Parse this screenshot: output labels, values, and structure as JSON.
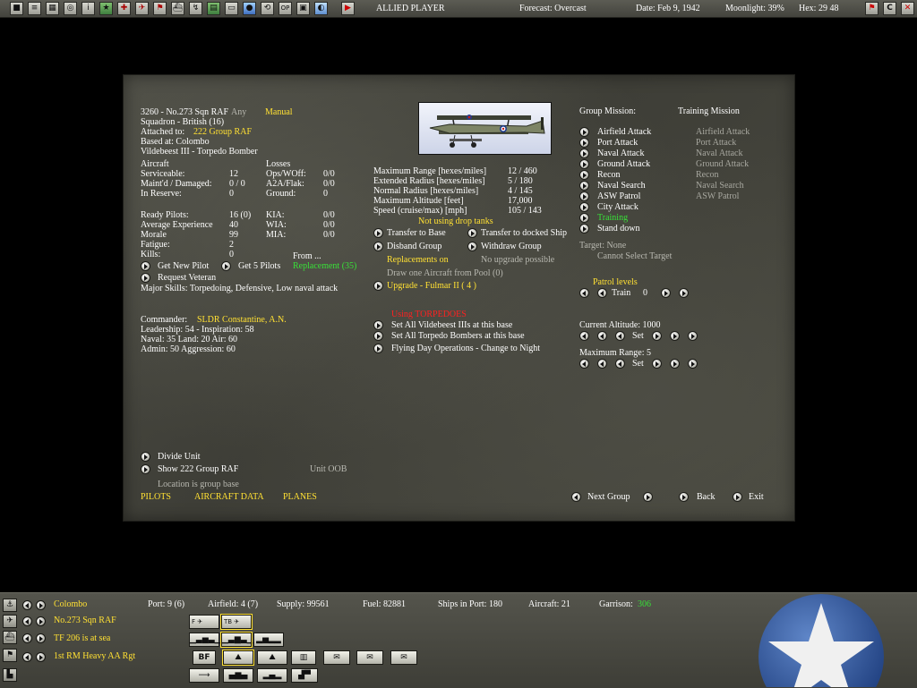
{
  "topbar": {
    "icons": [
      "turn-icon",
      "list-icon",
      "map-icon",
      "intel-icon",
      "reports-icon",
      "info-icon",
      "base-icon",
      "ground-icon",
      "air-icon",
      "flag-icon",
      "ship-icon",
      "route-icon",
      "chart-icon",
      "cargo-icon",
      "globe-icon",
      "replay-icon",
      "op-icon",
      "options-icon",
      "planes-icon"
    ],
    "op_label": "OP",
    "info_label": "i",
    "side": "ALLIED PLAYER",
    "forecast": "Forecast: Overcast",
    "date": "Date: Feb 9, 1942",
    "moonlight": "Moonlight: 39%",
    "hex": "Hex: 29 48",
    "c_label": "C",
    "x_label": "✕"
  },
  "unit": {
    "header": "3260 - No.273 Sqn RAF",
    "any": "Any",
    "manual": "Manual",
    "squadron": "Squadron - British (16)",
    "attached_label": "Attached to:",
    "attached_value": "222 Group RAF",
    "based_at": "Based at: Colombo",
    "aircraft_type": "Vildebeest III - Torpedo Bomber",
    "aircraft_label": "Aircraft",
    "losses_label": "Losses",
    "serviceable_label": "Serviceable:",
    "serviceable": "12",
    "ops_label": "Ops/WOff:",
    "ops": "0/0",
    "maint_label": "Maint'd / Damaged:",
    "maint": "0 / 0",
    "aaflak_label": "A2A/Flak:",
    "aaflak": "0/0",
    "reserve_label": "In Reserve:",
    "reserve": "0",
    "ground_label": "Ground:",
    "ground": "0",
    "ready_pilots_label": "Ready Pilots:",
    "ready_pilots": "16 (0)",
    "kia_label": "KIA:",
    "kia": "0/0",
    "avg_exp_label": "Average Experience",
    "avg_exp": "40",
    "wia_label": "WIA:",
    "wia": "0/0",
    "morale_label": "Morale",
    "morale": "99",
    "mia_label": "MIA:",
    "mia": "0/0",
    "fatigue_label": "Fatigue:",
    "fatigue": "2",
    "kills_label": "Kills:",
    "kills": "0",
    "from": "From ...",
    "get_new_pilot": "Get New Pilot",
    "get_5_pilots": "Get 5 Pilots",
    "replacement": "Replacement (35)",
    "request_veteran": "Request Veteran",
    "skills": "Major Skills:  Torpedoing, Defensive, Low naval attack",
    "commander_label": "Commander:",
    "commander": "SLDR Constantine, A.N.",
    "leadership": "Leadership: 54 - Inspiration: 58",
    "naval": " Naval:  35  Land:  20  Air:  60",
    "admin": " Admin:  50  Aggression:  60",
    "divide_unit": "Divide Unit",
    "show_group": "Show 222 Group RAF",
    "unit_oob": "Unit OOB",
    "location": "Location is group base",
    "tab_pilots": "PILOTS",
    "tab_aircraft_data": "AIRCRAFT DATA",
    "tab_planes": "PLANES"
  },
  "aircraft": {
    "max_range_label": "Maximum Range [hexes/miles]",
    "max_range": "12 / 460",
    "ext_radius_label": "Extended Radius [hexes/miles]",
    "ext_radius": "5 / 180",
    "norm_radius_label": "Normal Radius [hexes/miles]",
    "norm_radius": "4 / 145",
    "max_alt_label": "Maximum Altitude [feet]",
    "max_alt": "17,000",
    "speed_label": "Speed (cruise/max) [mph]",
    "speed": "105 / 143",
    "drop_tanks": "Not using drop tanks",
    "transfer_base": "Transfer to Base",
    "transfer_ship": "Transfer to docked Ship",
    "disband": "Disband Group",
    "withdraw": "Withdraw Group",
    "replacements_on": "Replacements on",
    "no_upgrade": "No upgrade possible",
    "draw_one": "Draw one Aircraft from Pool (0)",
    "upgrade": "Upgrade - Fulmar II  ( 4 )",
    "wing_label": "Using TORPEDOES",
    "set_all_type": "Set All Vildebeest IIIs at this base",
    "set_all_torpedo": "Set All Torpedo Bombers at this base",
    "flying_day": "Flying Day Operations - Change to Night"
  },
  "mission": {
    "group_label": "Group Mission:",
    "training_label": "Training Mission",
    "items": [
      {
        "label": "Airfield Attack",
        "train": "Airfield Attack"
      },
      {
        "label": "Port Attack",
        "train": "Port Attack"
      },
      {
        "label": "Naval Attack",
        "train": "Naval Attack"
      },
      {
        "label": "Ground Attack",
        "train": "Ground Attack"
      },
      {
        "label": "Recon",
        "train": "Recon"
      },
      {
        "label": "Naval Search",
        "train": "Naval Search"
      },
      {
        "label": "ASW Patrol",
        "train": "ASW Patrol"
      },
      {
        "label": "City Attack",
        "train": ""
      },
      {
        "label": "Training",
        "train": ""
      },
      {
        "label": "Stand down",
        "train": ""
      }
    ],
    "target": "Target: None",
    "cannot_select": "Cannot Select Target",
    "patrol_levels": "Patrol levels",
    "train_label": "Train",
    "train_value": "0",
    "current_alt": "Current Altitude: 1000",
    "set_label": "Set",
    "max_range": "Maximum Range: 5",
    "next_group": "Next Group",
    "back": "Back",
    "exit": "Exit"
  },
  "bottom": {
    "location": "Colombo",
    "port": "Port: 9 (6)",
    "airfield": "Airfield: 4 (7)",
    "supply": "Supply: 99561",
    "fuel": "Fuel: 82881",
    "ships": "Ships in Port: 180",
    "aircraft": "Aircraft: 21",
    "garrison_label": "Garrison:",
    "garrison": "306",
    "unit": "No.273 Sqn RAF",
    "tf": "TF 206 is at sea",
    "ground_unit": "1st RM Heavy AA Rgt",
    "ico_f": "F",
    "ico_tb": "TB",
    "ico_bf": "BF"
  }
}
